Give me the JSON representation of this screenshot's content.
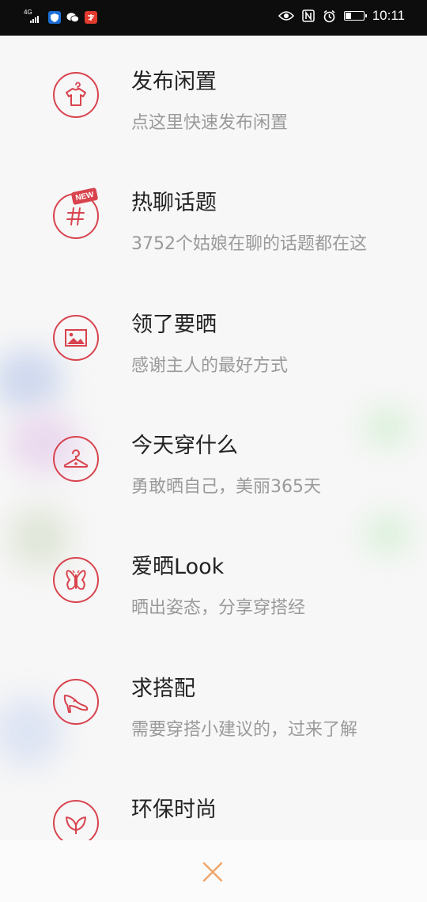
{
  "status_bar": {
    "network": "4G",
    "time": "10:11",
    "battery_level": 0.35
  },
  "menu": {
    "items": [
      {
        "title": "发布闲置",
        "subtitle": "点这里快速发布闲置",
        "icon": "tshirt-hanger-icon"
      },
      {
        "title": "热聊话题",
        "subtitle": "3752个姑娘在聊的话题都在这",
        "icon": "hashtag-icon",
        "badge": "NEW"
      },
      {
        "title": "领了要晒",
        "subtitle": "感谢主人的最好方式",
        "icon": "picture-icon"
      },
      {
        "title": "今天穿什么",
        "subtitle": "勇敢晒自己，美丽365天",
        "icon": "clothes-hanger-icon"
      },
      {
        "title": "爱晒Look",
        "subtitle": "晒出姿态，分享穿搭经",
        "icon": "butterfly-icon"
      },
      {
        "title": "求搭配",
        "subtitle": "需要穿搭小建议的，过来了解",
        "icon": "high-heel-icon"
      },
      {
        "title": "环保时尚",
        "subtitle": "",
        "icon": "leaf-icon"
      }
    ]
  },
  "colors": {
    "accent": "#d8434e",
    "close": "#f0a468",
    "title": "#222222",
    "subtitle": "#9a9a9a"
  }
}
